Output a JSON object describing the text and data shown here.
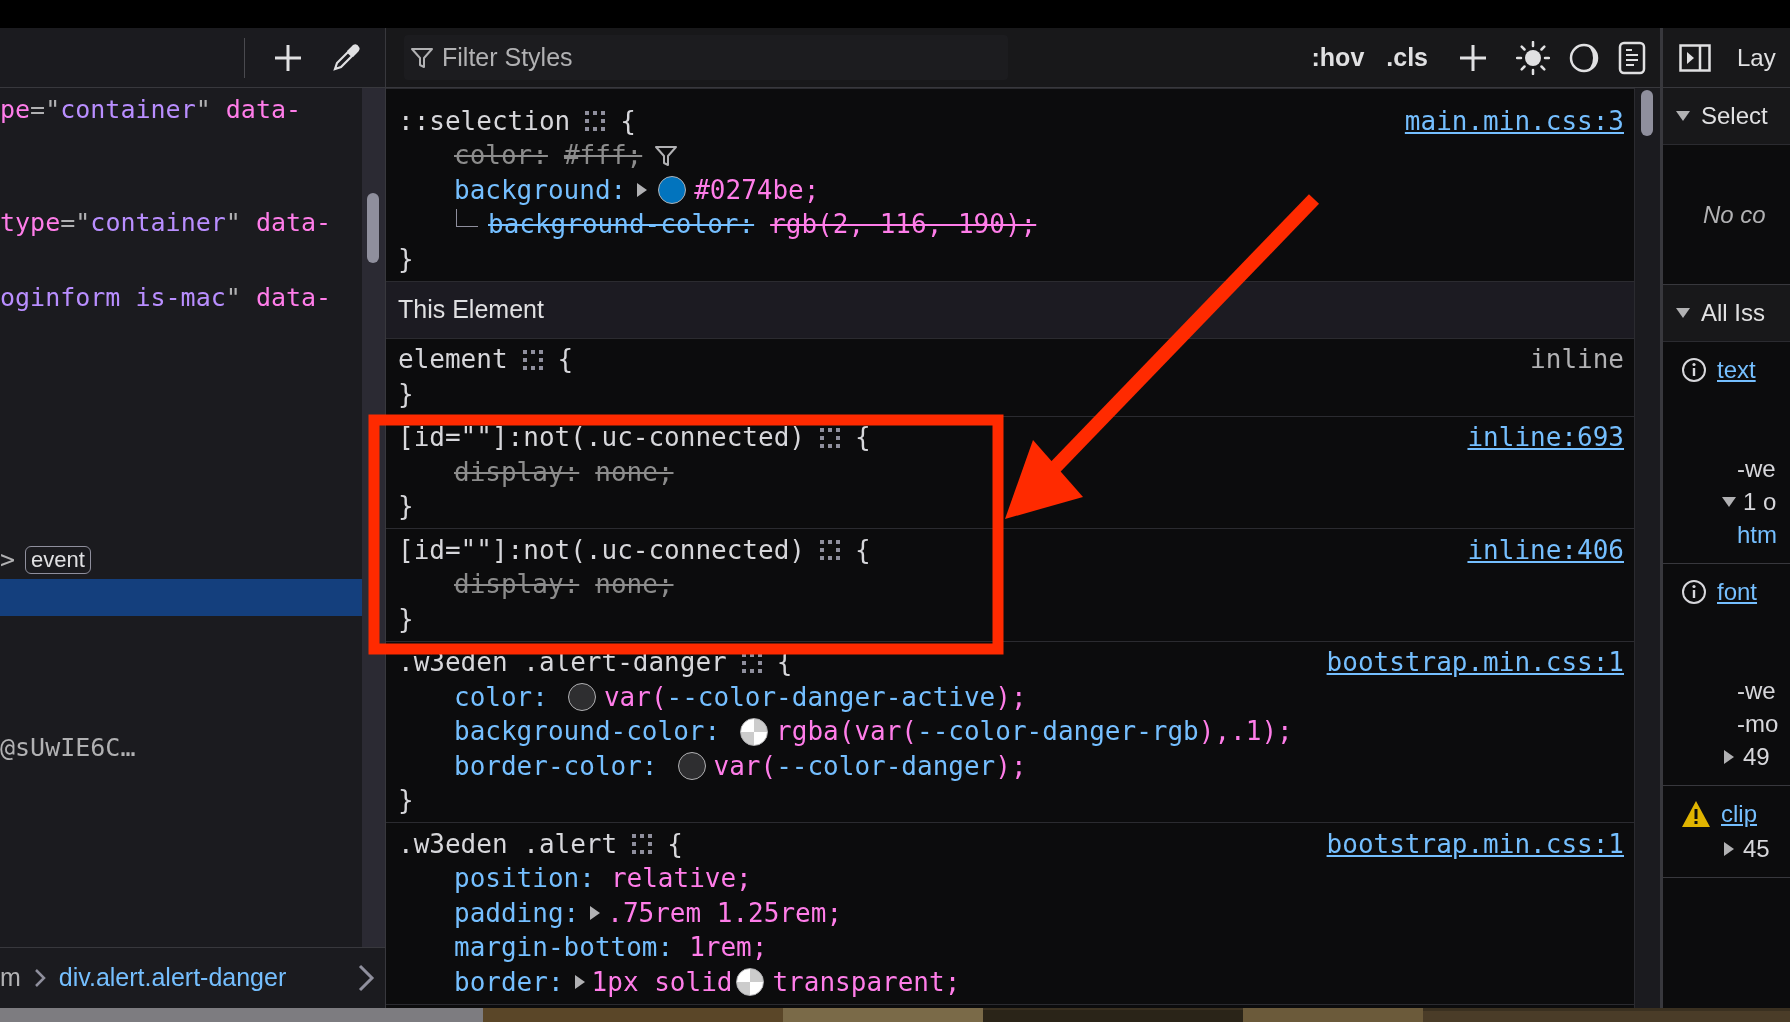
{
  "markup_panel": {
    "rows": [
      {
        "tokens": [
          {
            "kind": "attr",
            "text": "pe"
          },
          {
            "kind": "punct",
            "text": "=\""
          },
          {
            "kind": "value",
            "text": "container"
          },
          {
            "kind": "punct",
            "text": "\""
          },
          {
            "kind": "attr",
            "text": " data-"
          }
        ],
        "selected": false
      },
      {
        "selected": false
      },
      {
        "selected": false
      },
      {
        "tokens": [
          {
            "kind": "attr",
            "text": "type"
          },
          {
            "kind": "punct",
            "text": "=\""
          },
          {
            "kind": "value",
            "text": "container"
          },
          {
            "kind": "punct",
            "text": "\""
          },
          {
            "kind": "attr",
            "text": " data-"
          }
        ],
        "selected": false
      },
      {
        "selected": false
      },
      {
        "tokens": [
          {
            "kind": "value",
            "text": "oginform is-mac"
          },
          {
            "kind": "punct",
            "text": "\""
          },
          {
            "kind": "attr",
            "text": " data-"
          }
        ],
        "selected": false
      },
      {
        "selected": false
      },
      {
        "selected": false
      },
      {
        "selected": false
      },
      {
        "selected": false
      },
      {
        "selected": false
      },
      {
        "selected": false
      },
      {
        "tokens": [
          {
            "kind": "punct",
            "text": ">"
          },
          {
            "kind": "badge",
            "text": "event"
          }
        ],
        "selected": false
      },
      {
        "selected": true
      },
      {
        "selected": false
      },
      {
        "selected": false
      },
      {
        "selected": false
      },
      {
        "tokens": [
          {
            "kind": "plain",
            "text": "@sUwIE6C…"
          }
        ],
        "selected": false
      }
    ],
    "breadcrumbs": [
      {
        "text": "m",
        "selected": false
      },
      {
        "text": "div.alert.alert-danger",
        "selected": true
      }
    ]
  },
  "rules_panel": {
    "filter": {
      "placeholder": "Filter Styles"
    },
    "toggles": [
      ":hov",
      ".cls"
    ],
    "sections": [
      {
        "kind": "rule",
        "selector": "::selection",
        "open": "{",
        "close": "}",
        "source": "main.min.css:3",
        "declarations": [
          {
            "property": "color:",
            "value": "#fff;",
            "struck": true,
            "dimmed": true,
            "filter_icon": true
          },
          {
            "property": "background:",
            "expander": true,
            "value": [
              {
                "kind": "swatch",
                "color": "#0274be"
              },
              {
                "kind": "text",
                "text": "#0274be;"
              }
            ],
            "children": [
              {
                "property": "background-color:",
                "value": "rgb(2, 116, 190);",
                "struck": true
              }
            ]
          }
        ]
      },
      {
        "kind": "header",
        "title": "This Element"
      },
      {
        "kind": "rule",
        "selector": "element",
        "open": "{",
        "close": "}",
        "origin": "inline"
      },
      {
        "kind": "rule",
        "selector": "[id=\"\"]:not(.uc-connected)",
        "open": "{",
        "close": "}",
        "source": "inline:693",
        "declarations": [
          {
            "property": "display:",
            "value": "none;",
            "struck": true,
            "dimmed": true
          }
        ]
      },
      {
        "kind": "rule",
        "selector": "[id=\"\"]:not(.uc-connected)",
        "open": "{",
        "close": "}",
        "source": "inline:406",
        "declarations": [
          {
            "property": "display:",
            "value": "none;",
            "struck": true,
            "dimmed": true
          }
        ]
      },
      {
        "kind": "rule",
        "selector": ".w3eden .alert-danger",
        "open": "{",
        "close": "}",
        "source": "bootstrap.min.css:1",
        "declarations": [
          {
            "property": "color:",
            "value": [
              {
                "kind": "swatch",
                "color": "#2e2e30"
              },
              {
                "kind": "text",
                "text": "var("
              },
              {
                "kind": "var",
                "text": "--color-danger-active"
              },
              {
                "kind": "text",
                "text": ");"
              }
            ]
          },
          {
            "property": "background-color:",
            "value": [
              {
                "kind": "checker-swatch"
              },
              {
                "kind": "text",
                "text": "rgba(var("
              },
              {
                "kind": "var",
                "text": "--color-danger-rgb"
              },
              {
                "kind": "text",
                "text": "),.1);"
              }
            ]
          },
          {
            "property": "border-color:",
            "value": [
              {
                "kind": "swatch",
                "color": "#2e2e30"
              },
              {
                "kind": "text",
                "text": "var("
              },
              {
                "kind": "var",
                "text": "--color-danger"
              },
              {
                "kind": "text",
                "text": ");"
              }
            ]
          }
        ]
      },
      {
        "kind": "rule",
        "selector": ".w3eden .alert",
        "open": "{",
        "source": "bootstrap.min.css:1",
        "declarations": [
          {
            "property": "position:",
            "value": "relative;"
          },
          {
            "property": "padding:",
            "expander": true,
            "value": ".75rem 1.25rem;"
          },
          {
            "property": "margin-bottom:",
            "value": "1rem;"
          },
          {
            "property": "border:",
            "expander": true,
            "value": [
              {
                "kind": "text",
                "text": "1px solid"
              },
              {
                "kind": "checker-swatch"
              },
              {
                "kind": "text",
                "text": "transparent;"
              }
            ]
          }
        ]
      }
    ]
  },
  "sidebar": {
    "tab": "Lay",
    "sections": [
      {
        "title": "Select",
        "expanded": true,
        "message": "No co"
      },
      {
        "title": "All Iss",
        "expanded": true,
        "issues": [
          {
            "kind": "info",
            "link": "text",
            "lines": [
              {
                "kind": "text",
                "text": "-we"
              },
              {
                "kind": "toggle",
                "expanded": true,
                "text": "1 o"
              },
              {
                "kind": "link",
                "text": "htm"
              }
            ]
          },
          {
            "kind": "info",
            "link": "font",
            "lines": [
              {
                "kind": "text",
                "text": "-we"
              },
              {
                "kind": "text",
                "text": "-mo"
              },
              {
                "kind": "toggle",
                "expanded": false,
                "text": "49"
              }
            ]
          },
          {
            "kind": "warning",
            "link": "clip",
            "lines": [
              {
                "kind": "toggle",
                "expanded": false,
                "text": "45"
              }
            ]
          }
        ]
      }
    ]
  }
}
